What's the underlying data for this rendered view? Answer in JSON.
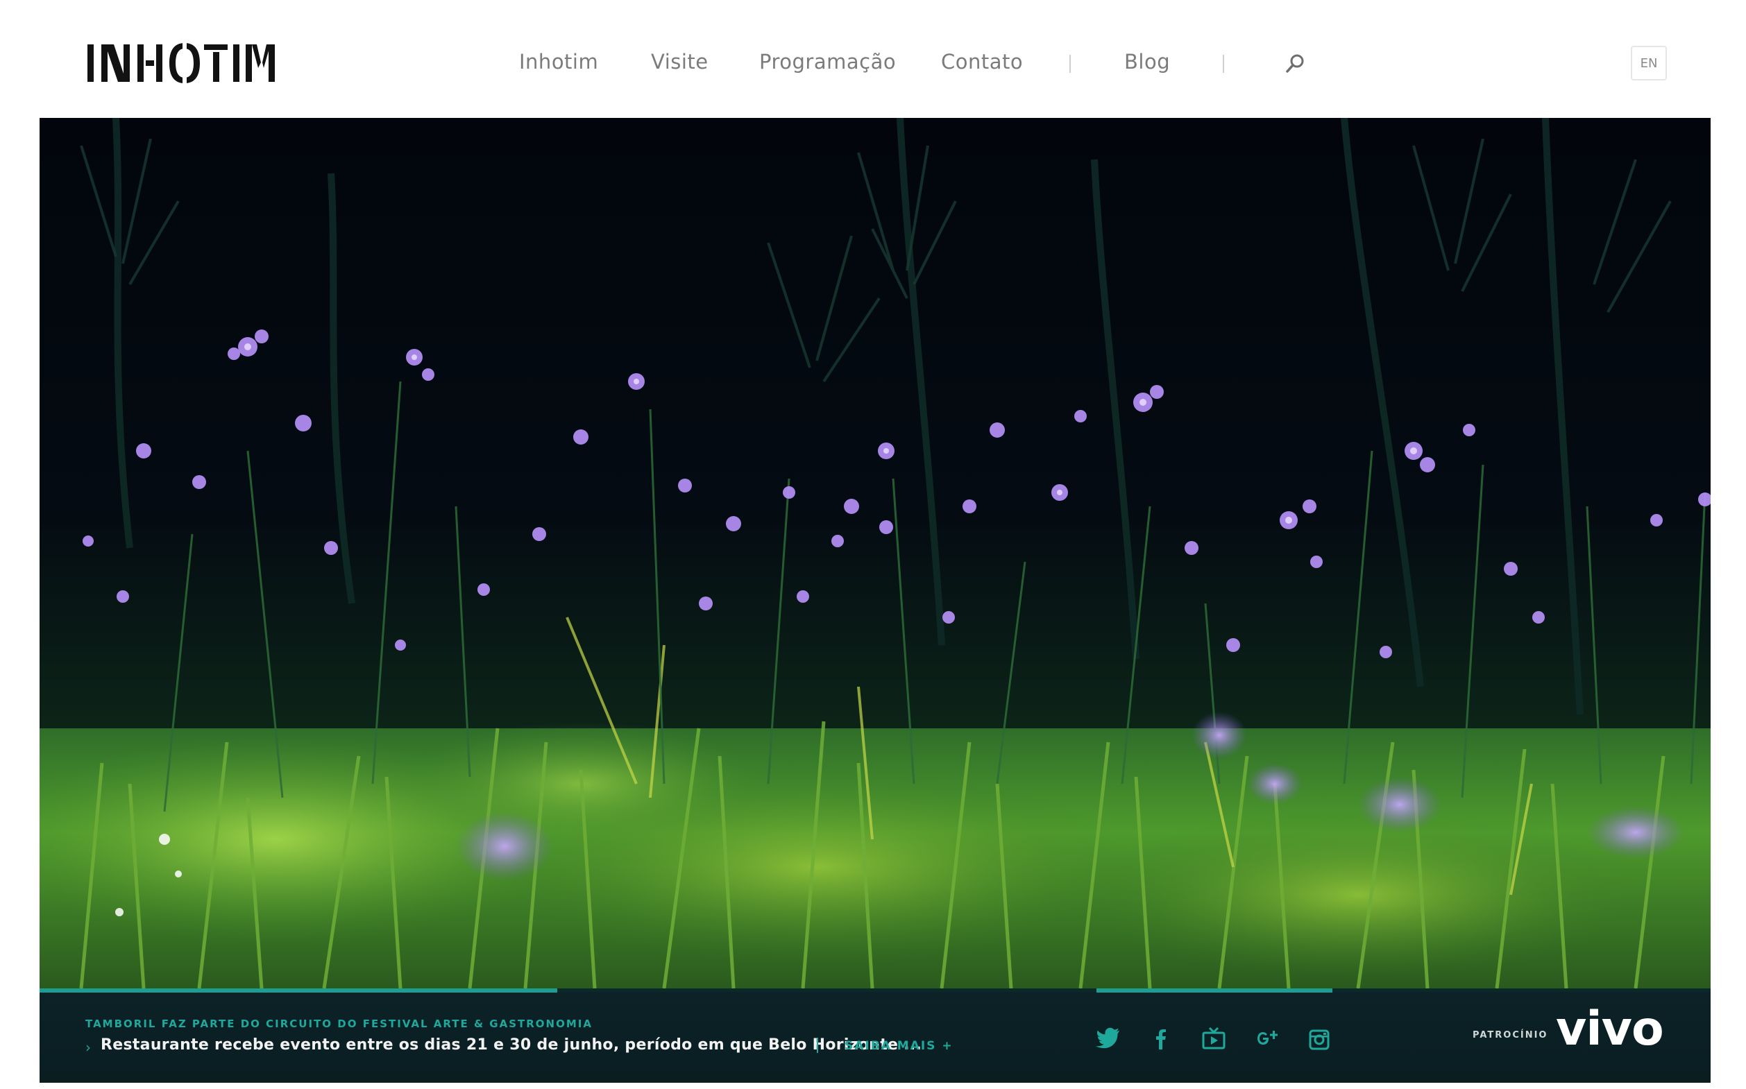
{
  "header": {
    "logo_text": "INHOTIM",
    "nav": [
      {
        "label": "Inhotim"
      },
      {
        "label": "Visite"
      },
      {
        "label": "Programação"
      },
      {
        "label": "Contato"
      },
      {
        "label": "Blog"
      }
    ],
    "search_icon": "search-icon",
    "language": "EN"
  },
  "hero": {
    "image": "night garden with purple flowers and tall grass"
  },
  "news": {
    "kicker": "TAMBORIL FAZ PARTE DO CIRCUITO DO FESTIVAL ARTE & GASTRONOMIA",
    "headline": "Restaurante recebe evento entre os dias 21 e 30 de junho, período em que Belo Horizonte ...",
    "arrow": "›",
    "more_label": "SAIBA MAIS +"
  },
  "social": [
    {
      "icon": "twitter-icon"
    },
    {
      "icon": "facebook-icon"
    },
    {
      "icon": "tv-icon"
    },
    {
      "icon": "google-plus-icon"
    },
    {
      "icon": "instagram-icon"
    }
  ],
  "sponsor": {
    "label": "PATROCÍNIO",
    "brand": "vivo"
  },
  "colors": {
    "accent": "#1fa89c",
    "bar_bg": "#0c2227",
    "nav_text": "#7b7b7b"
  }
}
